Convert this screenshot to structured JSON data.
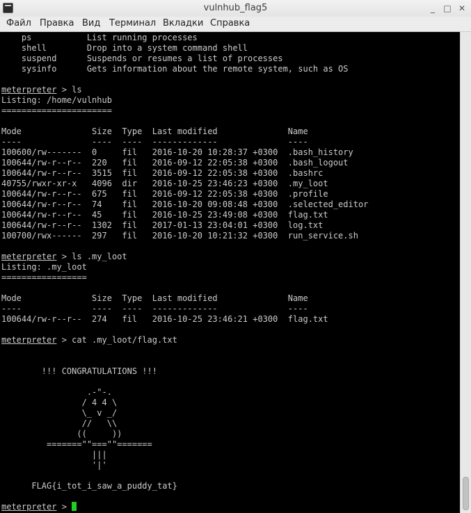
{
  "window": {
    "title": "vulnhub_flag5",
    "buttons": {
      "minimize": "_",
      "maximize": "□",
      "close": "✕"
    }
  },
  "menu": [
    "Файл",
    "Правка",
    "Вид",
    "Терминал",
    "Вкладки",
    "Справка"
  ],
  "terminal": {
    "lines": [
      "    ps           List running processes",
      "    shell        Drop into a system command shell",
      "    suspend      Suspends or resumes a list of processes",
      "    sysinfo      Gets information about the remote system, such as OS",
      "",
      "meterpreter > ls",
      "Listing: /home/vulnhub",
      "======================",
      "",
      "Mode              Size  Type  Last modified              Name",
      "----              ----  ----  -------------              ----",
      "100600/rw-------  0     fil   2016-10-20 10:28:37 +0300  .bash_history",
      "100644/rw-r--r--  220   fil   2016-09-12 22:05:38 +0300  .bash_logout",
      "100644/rw-r--r--  3515  fil   2016-09-12 22:05:38 +0300  .bashrc",
      "40755/rwxr-xr-x   4096  dir   2016-10-25 23:46:23 +0300  .my_loot",
      "100644/rw-r--r--  675   fil   2016-09-12 22:05:38 +0300  .profile",
      "100644/rw-r--r--  74    fil   2016-10-20 09:08:48 +0300  .selected_editor",
      "100644/rw-r--r--  45    fil   2016-10-25 23:49:08 +0300  flag.txt",
      "100644/rw-r--r--  1302  fil   2017-01-13 23:04:01 +0300  log.txt",
      "100700/rwx------  297   fil   2016-10-20 10:21:32 +0300  run_service.sh",
      "",
      "meterpreter > ls .my_loot",
      "Listing: .my_loot",
      "=================",
      "",
      "Mode              Size  Type  Last modified              Name",
      "----              ----  ----  -------------              ----",
      "100644/rw-r--r--  274   fil   2016-10-25 23:46:21 +0300  flag.txt",
      "",
      "meterpreter > cat .my_loot/flag.txt",
      "",
      "",
      "        !!! CONGRATULATIONS !!!",
      "",
      "                 .-\"-.",
      "                / 4 4 \\",
      "                \\_ v _/",
      "                //   \\\\",
      "               ((     ))",
      "         =======\"\"===\"\"=======",
      "                  |||",
      "                  '|'",
      "",
      "      FLAG{i_tot_i_saw_a_puddy_tat}",
      "",
      "meterpreter > "
    ],
    "prompt_word": "meterpreter",
    "accent_color": "#20d020"
  }
}
